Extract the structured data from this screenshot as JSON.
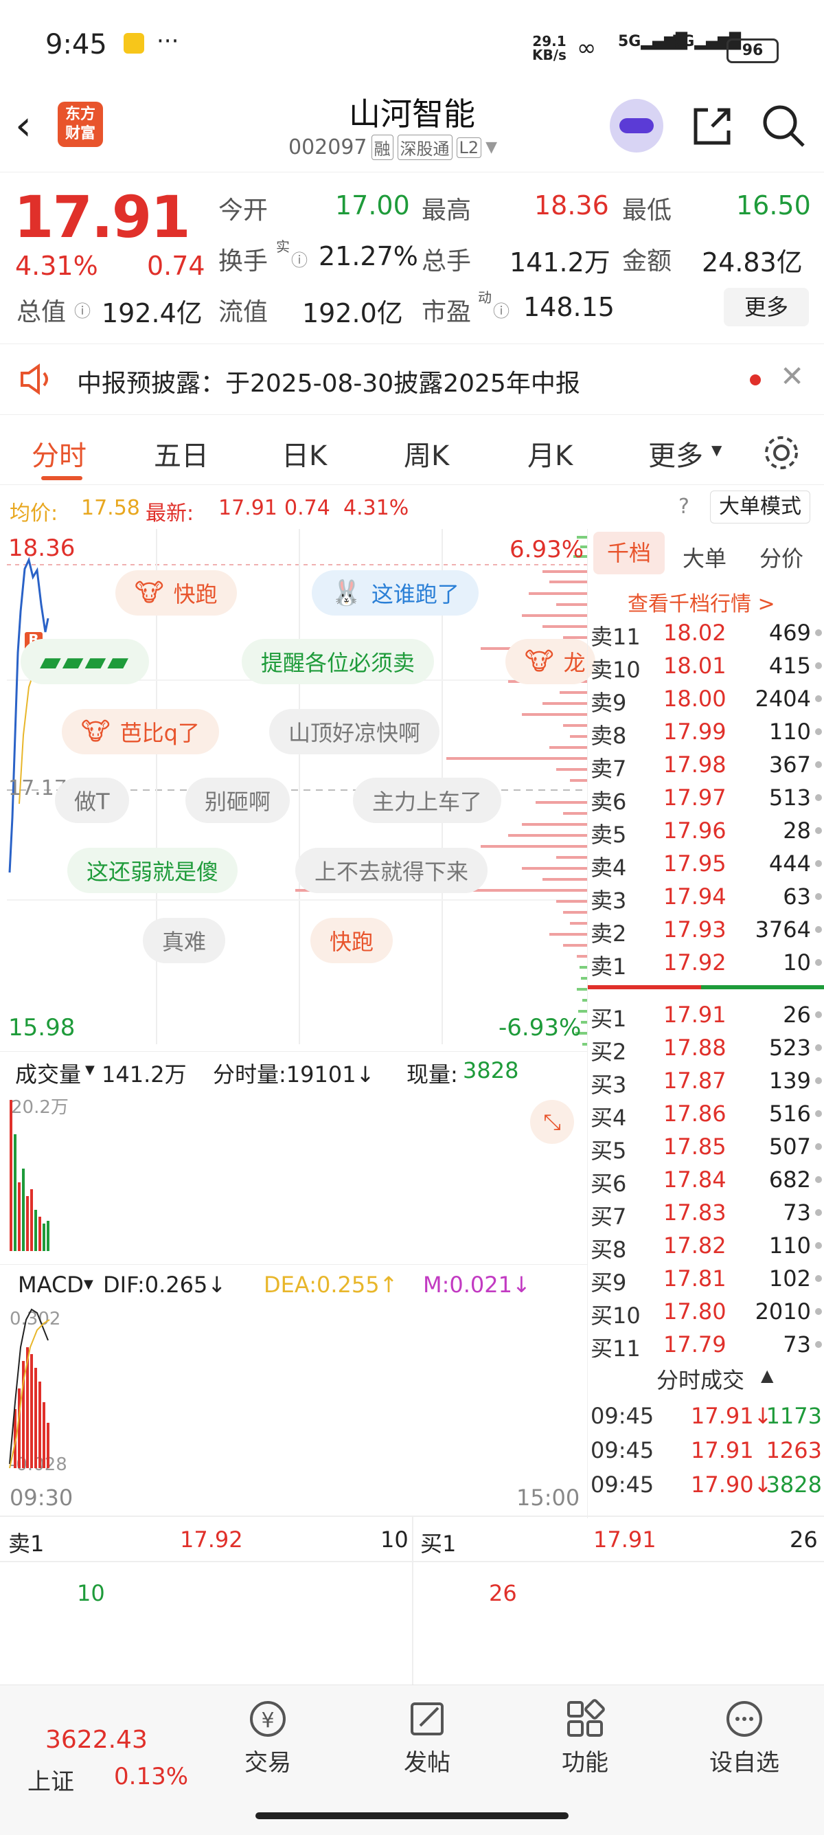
{
  "status_bar": {
    "time": "9:45",
    "net_speed_top": "29.1",
    "net_speed_bottom": "KB/s",
    "battery": "96"
  },
  "header": {
    "logo_line1": "东方",
    "logo_line2": "财富",
    "title": "山河智能",
    "code": "002097",
    "tag1": "融",
    "tag2": "深股通",
    "tag3": "L2"
  },
  "quote": {
    "price": "17.91",
    "change_pct": "4.31%",
    "change": "0.74",
    "open_label": "今开",
    "open": "17.00",
    "high_label": "最高",
    "high": "18.36",
    "low_label": "最低",
    "low": "16.50",
    "turnover_label": "换手",
    "turnover_sup": "实",
    "turnover": "21.27%",
    "volume_label": "总手",
    "volume": "141.2万",
    "amount_label": "金额",
    "amount": "24.83亿",
    "mktcap_label": "总值",
    "mktcap": "192.4亿",
    "float_label": "流值",
    "float": "192.0亿",
    "pe_label": "市盈",
    "pe_sup": "动",
    "pe": "148.15",
    "more_label": "更多"
  },
  "notice": {
    "text": "中报预披露：于2025-08-30披露2025年中报"
  },
  "tabs": [
    "分时",
    "五日",
    "日K",
    "周K",
    "月K",
    "更多"
  ],
  "avg_line": {
    "avg_label": "均价:",
    "avg": "17.58",
    "latest_label": "最新:",
    "latest": "17.91",
    "change": "0.74",
    "pct": "4.31%",
    "mode_label": "大单模式"
  },
  "chart": {
    "y_top": "18.36",
    "y_mid": "17.17",
    "y_bottom": "15.98",
    "pct_top": "6.93%",
    "pct_bottom": "-6.93%",
    "marker": "B",
    "volume_label": "成交量",
    "volume_value": "141.2万",
    "fenshi_label": "分时量:19101↓",
    "current_label": "现量:",
    "current_value": "3828",
    "vol_max": "20.2万",
    "macd_label": "MACD",
    "dif": "DIF:0.265↓",
    "dea": "DEA:0.255↑",
    "m": "M:0.021↓",
    "macd_top": "0.302",
    "macd_bottom": "-0.028",
    "time_start": "09:30",
    "time_end": "15:00"
  },
  "bubbles": [
    {
      "text": "快跑"
    },
    {
      "text": "这谁跑了"
    },
    {
      "text": "提醒各位必须卖"
    },
    {
      "text": "龙"
    },
    {
      "text": "芭比q了"
    },
    {
      "text": "山顶好凉快啊"
    },
    {
      "text": "做T"
    },
    {
      "text": "别砸啊"
    },
    {
      "text": "主力上车了"
    },
    {
      "text": "这还弱就是傻"
    },
    {
      "text": "上不去就得下来"
    },
    {
      "text": "真难"
    },
    {
      "text": "快跑"
    }
  ],
  "orderbook": {
    "tabs": [
      "千档",
      "大单",
      "分价"
    ],
    "link": "查看千档行情 >",
    "asks": [
      {
        "label": "卖11",
        "price": "18.02",
        "vol": "469"
      },
      {
        "label": "卖10",
        "price": "18.01",
        "vol": "415"
      },
      {
        "label": "卖9",
        "price": "18.00",
        "vol": "2404"
      },
      {
        "label": "卖8",
        "price": "17.99",
        "vol": "110"
      },
      {
        "label": "卖7",
        "price": "17.98",
        "vol": "367"
      },
      {
        "label": "卖6",
        "price": "17.97",
        "vol": "513"
      },
      {
        "label": "卖5",
        "price": "17.96",
        "vol": "28"
      },
      {
        "label": "卖4",
        "price": "17.95",
        "vol": "444"
      },
      {
        "label": "卖3",
        "price": "17.94",
        "vol": "63"
      },
      {
        "label": "卖2",
        "price": "17.93",
        "vol": "3764"
      },
      {
        "label": "卖1",
        "price": "17.92",
        "vol": "10"
      }
    ],
    "bids": [
      {
        "label": "买1",
        "price": "17.91",
        "vol": "26"
      },
      {
        "label": "买2",
        "price": "17.88",
        "vol": "523"
      },
      {
        "label": "买3",
        "price": "17.87",
        "vol": "139"
      },
      {
        "label": "买4",
        "price": "17.86",
        "vol": "516"
      },
      {
        "label": "买5",
        "price": "17.85",
        "vol": "507"
      },
      {
        "label": "买6",
        "price": "17.84",
        "vol": "682"
      },
      {
        "label": "买7",
        "price": "17.83",
        "vol": "73"
      },
      {
        "label": "买8",
        "price": "17.82",
        "vol": "110"
      },
      {
        "label": "买9",
        "price": "17.81",
        "vol": "102"
      },
      {
        "label": "买10",
        "price": "17.80",
        "vol": "2010"
      },
      {
        "label": "买11",
        "price": "17.79",
        "vol": "73"
      }
    ],
    "ticks_label": "分时成交",
    "ticks": [
      {
        "time": "09:45",
        "price": "17.91↓",
        "vol": "1173"
      },
      {
        "time": "09:45",
        "price": "17.91",
        "vol": "1263"
      },
      {
        "time": "09:45",
        "price": "17.90↓",
        "vol": "3828"
      }
    ]
  },
  "bottom_quote": {
    "sell_label": "卖1",
    "sell_price": "17.92",
    "sell_vol": "10",
    "sell_vol2": "10",
    "buy_label": "买1",
    "buy_price": "17.91",
    "buy_vol": "26",
    "buy_vol2": "26"
  },
  "nav": {
    "index_value": "3622.43",
    "index_name": "上证",
    "index_pct": "0.13%",
    "items": [
      "交易",
      "发帖",
      "功能",
      "设自选"
    ]
  }
}
